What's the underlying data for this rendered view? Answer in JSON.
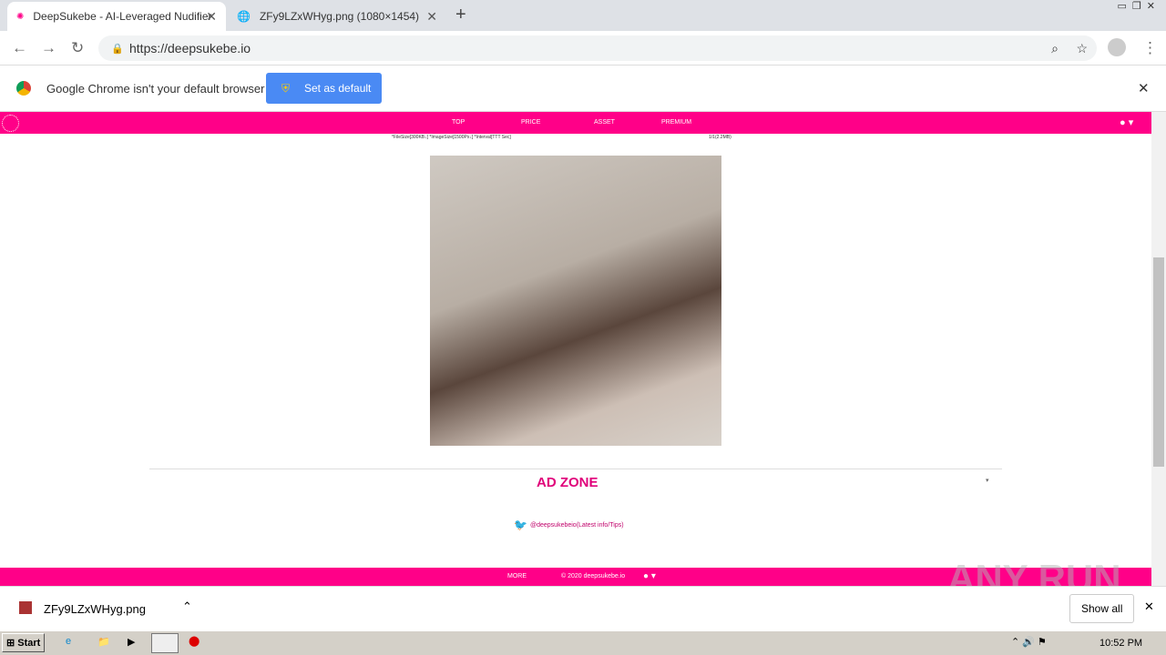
{
  "browser": {
    "tabs": [
      {
        "title": "DeepSukebe - AI-Leveraged Nudifier",
        "active": true
      },
      {
        "title": "ZFy9LZxWHyg.png (1080×1454)",
        "active": false
      }
    ],
    "url": "https://deepsukebe.io",
    "infobar": {
      "message": "Google Chrome isn't your default browser",
      "button": "Set as default"
    }
  },
  "site": {
    "brand_color": "#ff0088",
    "nav": [
      "TOP",
      "PRICE",
      "ASSET",
      "PREMIUM"
    ],
    "info_left": "*FileSize[300KB↓] *ImageSize[1500Px↓] *Interval[TTT Sec]",
    "info_right": "1/1(2.2MB)",
    "ad_zone": "AD ZONE",
    "twitter": "@deepsukebeio(Latest info/Tips)",
    "footer": {
      "more": "MORE",
      "copyright": "© 2020 deepsukebe.io"
    }
  },
  "downloads": {
    "file": "ZFy9LZxWHyg.png",
    "show_all": "Show all"
  },
  "taskbar": {
    "start": "Start",
    "time": "10:52 PM"
  },
  "watermark": "ANY RUN"
}
